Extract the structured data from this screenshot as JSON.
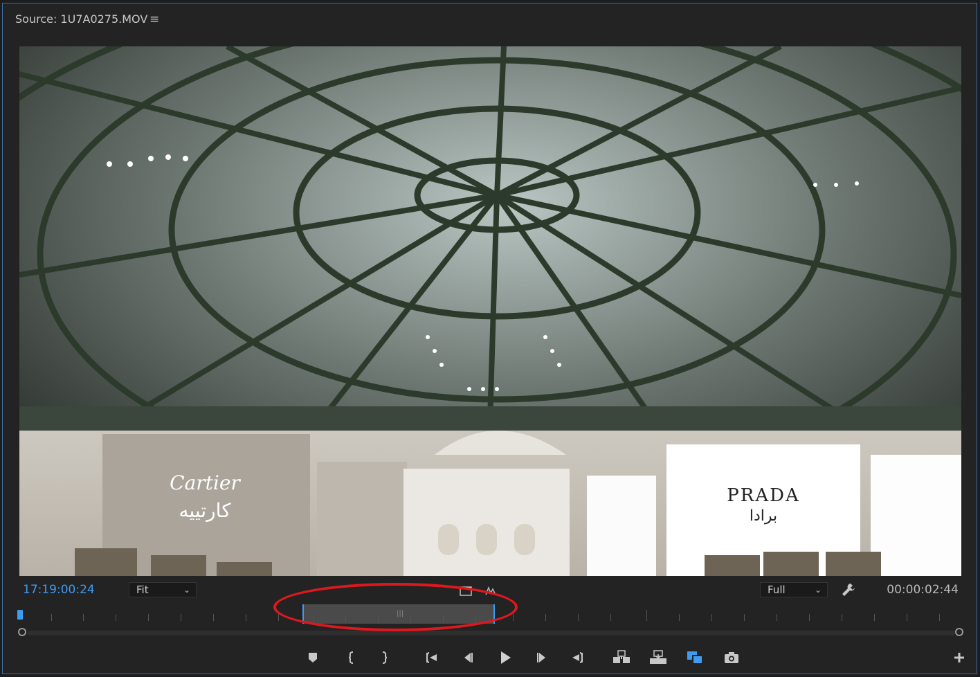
{
  "panel": {
    "title": "Source: 1U7A0275.MOV",
    "menu_icon": "hamburger-menu-icon"
  },
  "video": {
    "signs": {
      "cartier_latin": "Cartier",
      "cartier_arabic": "كارتييه",
      "prada_latin": "PRADA",
      "prada_arabic": "برادا"
    }
  },
  "controls": {
    "timecode_current": "17:19:00:24",
    "zoom_value": "Fit",
    "resolution_value": "Full",
    "duration": "00:00:02:44"
  },
  "transport": {
    "buttons": [
      "add-marker-icon",
      "mark-in-icon",
      "mark-out-icon",
      "go-to-in-icon",
      "step-back-icon",
      "play-icon",
      "step-forward-icon",
      "go-to-out-icon",
      "insert-icon",
      "overwrite-icon",
      "export-frame-icon-alt",
      "camera-icon",
      "add-button-icon"
    ]
  },
  "colors": {
    "accent_blue": "#3d9cf0",
    "annotation_red": "#e0181e",
    "panel_bg": "#232323"
  }
}
